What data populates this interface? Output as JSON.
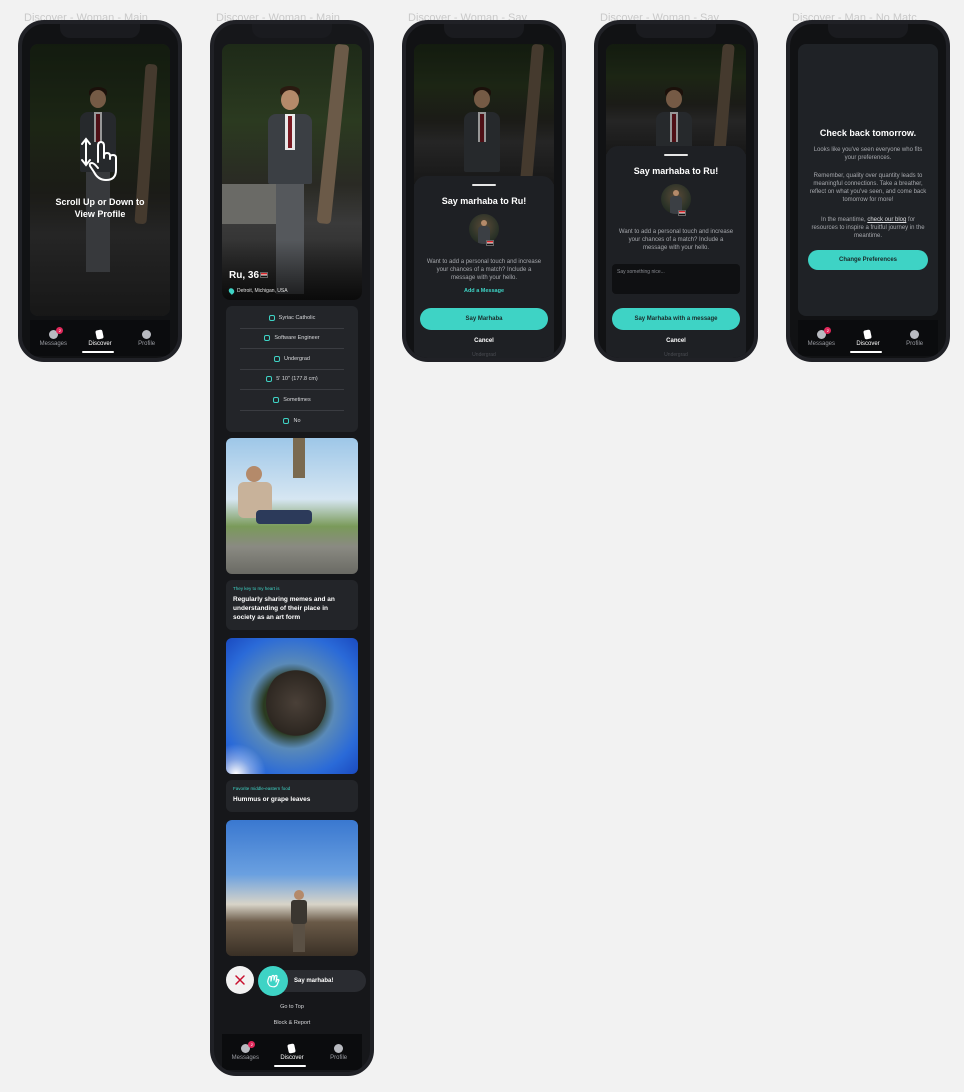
{
  "frames": {
    "f1": "Discover - Woman - Main",
    "f2": "Discover - Woman - Main",
    "f3": "Discover - Woman - Say",
    "f4": "Discover - Woman - Say",
    "f5": "Discover - Man - No Matc"
  },
  "nav": {
    "messages": "Messages",
    "discover": "Discover",
    "profile": "Profile",
    "badge": "2"
  },
  "screen1": {
    "hint": "Scroll Up or Down to View Profile"
  },
  "profile": {
    "name_age": "Ru, 36",
    "location": "Detroit, Michigan, USA",
    "details": [
      "Syriac Catholic",
      "Software Engineer",
      "Undergrad",
      "5' 10\" (177.8 cm)",
      "Sometimes",
      "No"
    ],
    "prompt1_label": "They key to my heart is",
    "prompt1_answer": "Regularly sharing memes and an understanding of their place in society as an art form",
    "prompt2_label": "Favorite middle-eastern food",
    "prompt2_answer": "Hummus or grape leaves",
    "say_marhaba": "Say marhaba!",
    "go_to_top": "Go to Top",
    "block_report": "Block & Report"
  },
  "say_sheet": {
    "title": "Say marhaba to Ru!",
    "text": "Want to add a personal touch and increase your chances of a match? Include a message with your hello.",
    "add_message": "Add a Message",
    "primary": "Say Marhaba",
    "primary_with_message": "Say Marhaba with a message",
    "cancel": "Cancel",
    "placeholder": "Say something nice...",
    "peek_label": "Undergrad"
  },
  "no_match": {
    "title": "Check back tomorrow.",
    "p1": "Looks like you've seen everyone who fits your preferences.",
    "p2": "Remember, quality over quantity leads to meaningful connections. Take a breather, reflect on what you've seen, and come back tomorrow for more!",
    "p3_pre": "In the meantime,",
    "p3_link": "check our blog",
    "p3_post": "for resources to inspire a fruitful journey in the meantime.",
    "button": "Change Preferences"
  },
  "colors": {
    "accent": "#3ed3c5",
    "badge": "#e0285a",
    "background": "#111214"
  }
}
